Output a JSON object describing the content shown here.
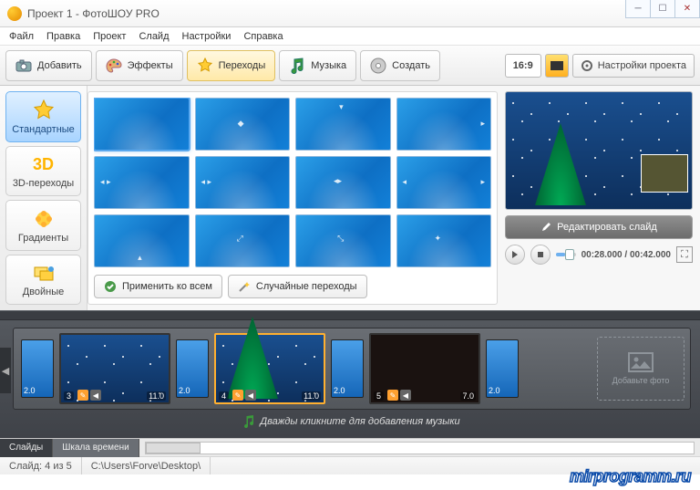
{
  "window": {
    "title": "Проект 1 - ФотоШОУ PRO"
  },
  "menu": [
    "Файл",
    "Правка",
    "Проект",
    "Слайд",
    "Настройки",
    "Справка"
  ],
  "toolbar": {
    "add": "Добавить",
    "effects": "Эффекты",
    "transitions": "Переходы",
    "music": "Музыка",
    "create": "Создать",
    "ratio": "16:9",
    "settings": "Настройки проекта"
  },
  "sidebar": {
    "items": [
      {
        "label": "Стандартные",
        "active": true
      },
      {
        "label": "3D-переходы"
      },
      {
        "label": "Градиенты"
      },
      {
        "label": "Двойные"
      }
    ],
    "threeD": "3D"
  },
  "gallery": {
    "applyAll": "Применить ко всем",
    "random": "Случайные переходы"
  },
  "preview": {
    "edit": "Редактировать слайд",
    "time": "00:28.000 / 00:42.000"
  },
  "timeline": {
    "transDur": "2.0",
    "slides": [
      {
        "num": "3",
        "dur": "11.0",
        "sel": false,
        "dark": false
      },
      {
        "num": "4",
        "dur": "11.0",
        "sel": true,
        "dark": false
      },
      {
        "num": "5",
        "dur": "7.0",
        "sel": false,
        "dark": true
      }
    ],
    "addPhoto": "Добавьте фото",
    "musicHint": "Дважды кликните для добавления музыки",
    "tabs": {
      "slides": "Слайды",
      "scale": "Шкала времени"
    }
  },
  "status": {
    "slide": "Слайд: 4 из 5",
    "path": "C:\\Users\\Forve\\Desktop\\"
  },
  "watermark": "mirprogramm.ru"
}
